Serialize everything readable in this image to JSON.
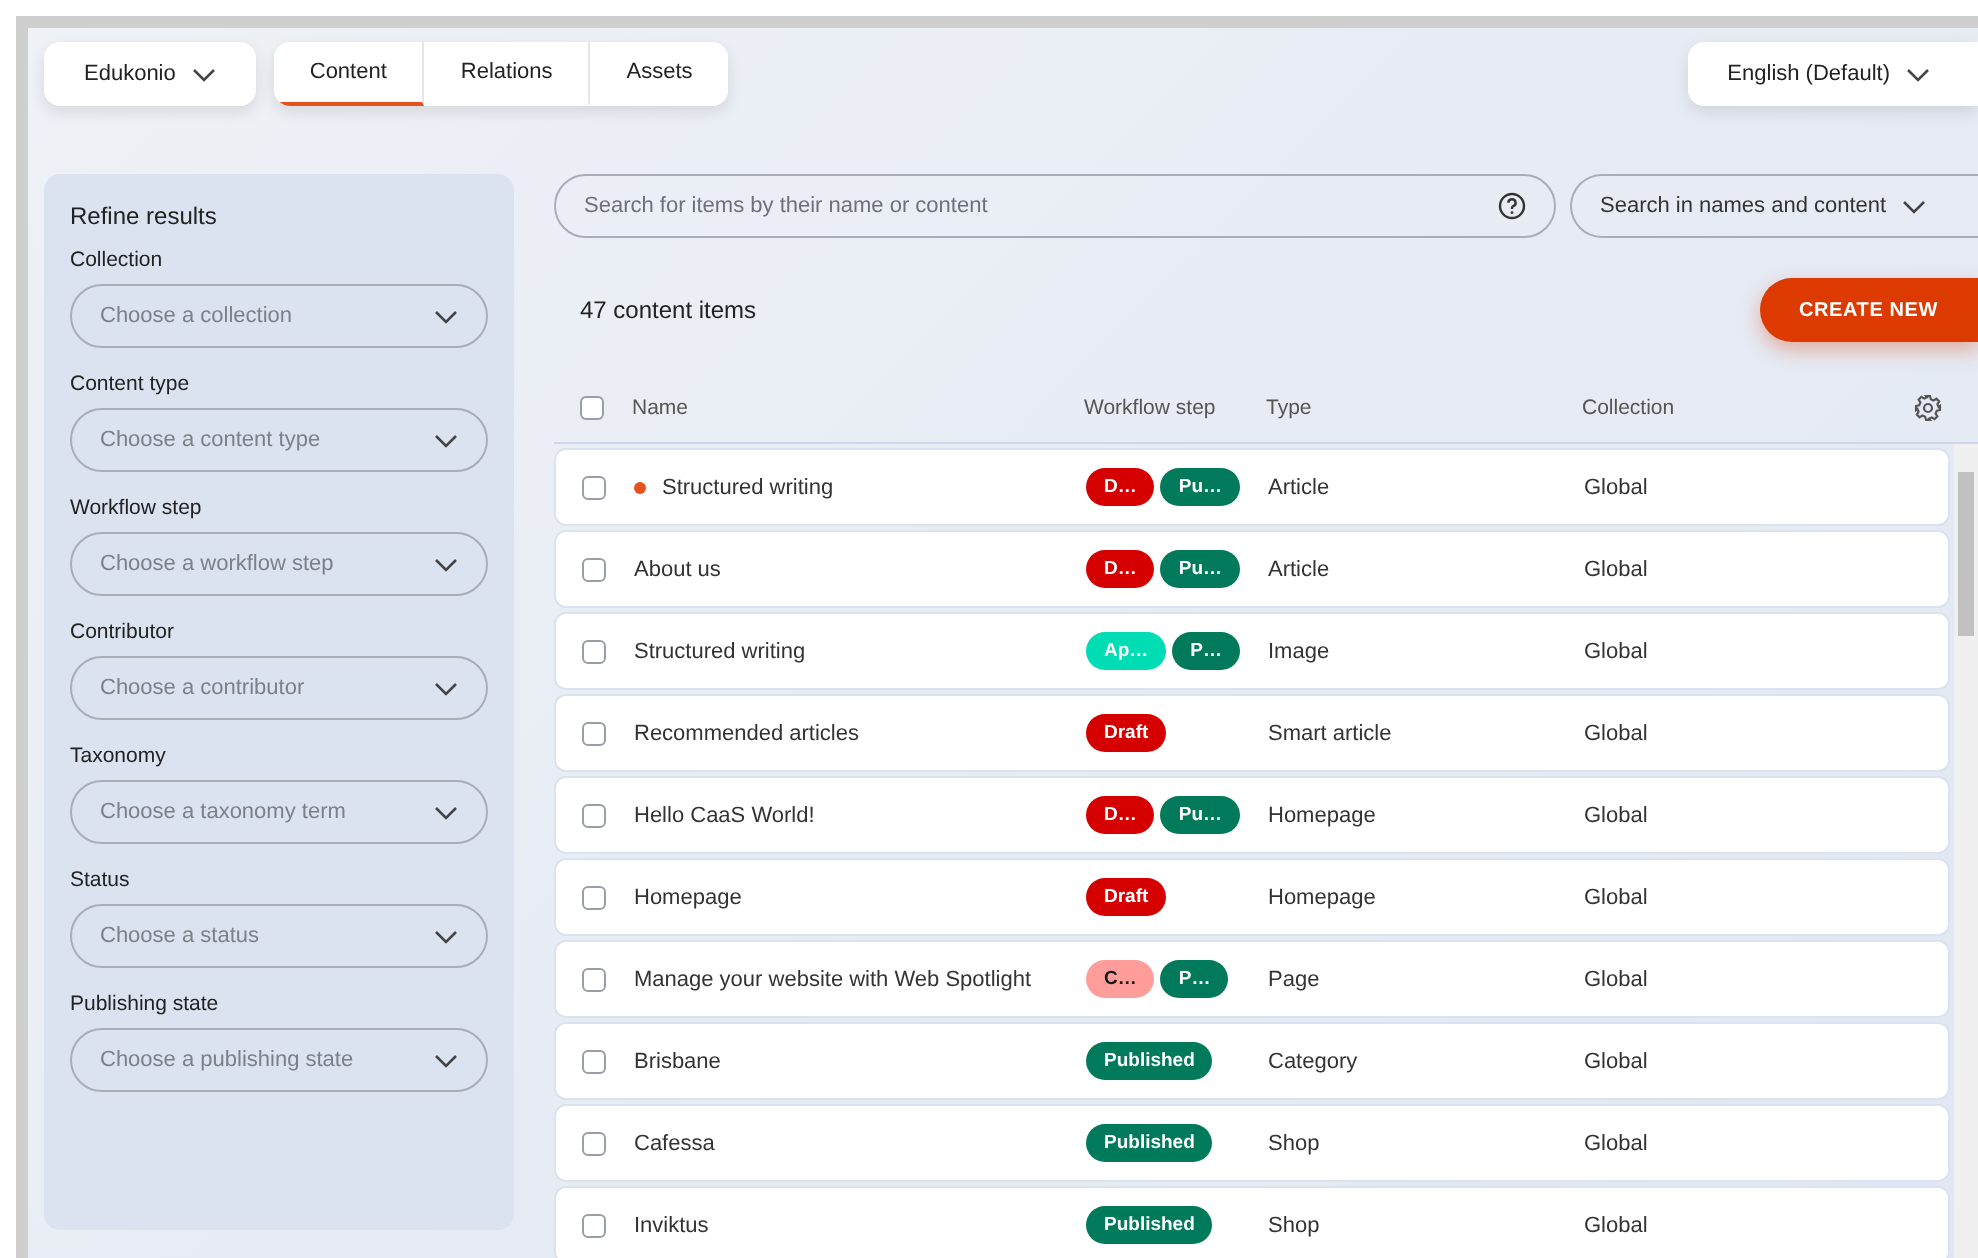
{
  "header": {
    "project": "Edukonio",
    "tabs": [
      {
        "label": "Content",
        "selected": true
      },
      {
        "label": "Relations",
        "selected": false
      },
      {
        "label": "Assets",
        "selected": false
      }
    ],
    "language": "English (Default)"
  },
  "sidebar": {
    "title": "Refine results",
    "filters": [
      {
        "label": "Collection",
        "placeholder": "Choose a collection"
      },
      {
        "label": "Content type",
        "placeholder": "Choose a content type"
      },
      {
        "label": "Workflow step",
        "placeholder": "Choose a workflow step"
      },
      {
        "label": "Contributor",
        "placeholder": "Choose a contributor"
      },
      {
        "label": "Taxonomy",
        "placeholder": "Choose a taxonomy term"
      },
      {
        "label": "Status",
        "placeholder": "Choose a status"
      },
      {
        "label": "Publishing state",
        "placeholder": "Choose a publishing state"
      }
    ]
  },
  "search": {
    "placeholder": "Search for items by their name or content",
    "scope": "Search in names and content"
  },
  "count": "47 content items",
  "create_button": "CREATE NEW",
  "table": {
    "all_checked": false,
    "columns": [
      "Name",
      "Workflow step",
      "Type",
      "Collection"
    ],
    "rows": [
      {
        "name": "Structured writing",
        "changed": true,
        "checked": false,
        "badges": [
          {
            "label": "D…",
            "color": "#d50000"
          },
          {
            "label": "Pu…",
            "color": "#007a5a"
          }
        ],
        "type": "Article",
        "collection": "Global"
      },
      {
        "name": "About us",
        "changed": false,
        "checked": false,
        "badges": [
          {
            "label": "D…",
            "color": "#d50000"
          },
          {
            "label": "Pu…",
            "color": "#007a5a"
          }
        ],
        "type": "Article",
        "collection": "Global"
      },
      {
        "name": "Structured writing",
        "changed": false,
        "checked": false,
        "badges": [
          {
            "label": "Ap…",
            "color": "#00dcb4"
          },
          {
            "label": "P…",
            "color": "#007a5a"
          }
        ],
        "type": "Image",
        "collection": "Global"
      },
      {
        "name": "Recommended articles",
        "changed": false,
        "checked": false,
        "badges": [
          {
            "label": "Draft",
            "color": "#d50000"
          }
        ],
        "type": "Smart article",
        "collection": "Global"
      },
      {
        "name": "Hello CaaS World!",
        "changed": false,
        "checked": false,
        "badges": [
          {
            "label": "D…",
            "color": "#d50000"
          },
          {
            "label": "Pu…",
            "color": "#007a5a"
          }
        ],
        "type": "Homepage",
        "collection": "Global"
      },
      {
        "name": "Homepage",
        "changed": false,
        "checked": false,
        "badges": [
          {
            "label": "Draft",
            "color": "#d50000"
          }
        ],
        "type": "Homepage",
        "collection": "Global"
      },
      {
        "name": "Manage your website with Web Spotlight",
        "changed": false,
        "checked": false,
        "badges": [
          {
            "label": "C…",
            "color": "#ff9d9a"
          },
          {
            "label": "P…",
            "color": "#007a5a"
          }
        ],
        "type": "Page",
        "collection": "Global"
      },
      {
        "name": "Brisbane",
        "changed": false,
        "checked": false,
        "badges": [
          {
            "label": "Published",
            "color": "#007a5a"
          }
        ],
        "type": "Category",
        "collection": "Global"
      },
      {
        "name": "Cafessa",
        "changed": false,
        "checked": false,
        "badges": [
          {
            "label": "Published",
            "color": "#007a5a"
          }
        ],
        "type": "Shop",
        "collection": "Global"
      },
      {
        "name": "Inviktus",
        "changed": false,
        "checked": false,
        "badges": [
          {
            "label": "Published",
            "color": "#007a5a"
          }
        ],
        "type": "Shop",
        "collection": "Global"
      }
    ]
  }
}
